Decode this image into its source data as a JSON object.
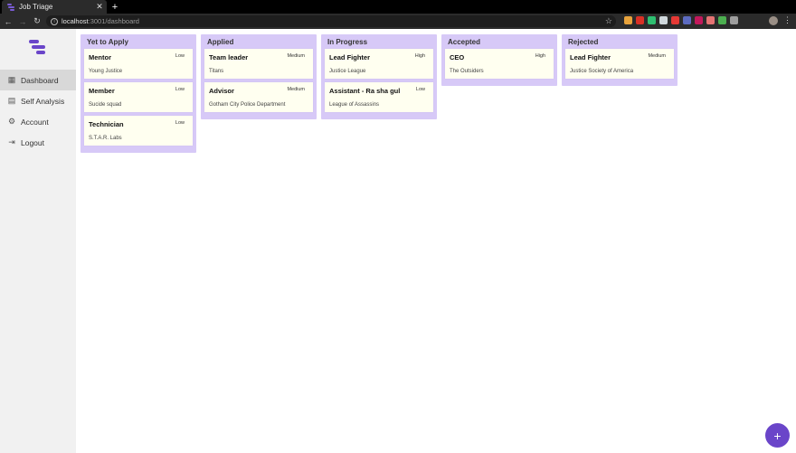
{
  "browser": {
    "tab_title": "Job Triage",
    "tab_close": "✕",
    "new_tab": "+",
    "url_host": "localhost",
    "url_path": ":3001/dashboard",
    "extension_colors": [
      "#e8a33c",
      "#d93025",
      "#2fbf71",
      "#cfd8dc",
      "#e53935",
      "#5c6bc0",
      "#c2185b",
      "#e57373",
      "#4caf50",
      "#9e9e9e"
    ]
  },
  "sidebar": {
    "items": [
      {
        "label": "Dashboard",
        "icon": "dashboard-icon",
        "glyph": "▦",
        "active": true
      },
      {
        "label": "Self Analysis",
        "icon": "clipboard-icon",
        "glyph": "▤",
        "active": false
      },
      {
        "label": "Account",
        "icon": "gear-icon",
        "glyph": "⚙",
        "active": false
      },
      {
        "label": "Logout",
        "icon": "logout-icon",
        "glyph": "⇥",
        "active": false
      }
    ]
  },
  "board": {
    "columns": [
      {
        "title": "Yet to Apply",
        "cards": [
          {
            "role": "Mentor",
            "priority": "Low",
            "company": "Young Justice"
          },
          {
            "role": "Member",
            "priority": "Low",
            "company": "Sucide squad"
          },
          {
            "role": "Technician",
            "priority": "Low",
            "company": "S.T.A.R. Labs"
          }
        ]
      },
      {
        "title": "Applied",
        "cards": [
          {
            "role": "Team leader",
            "priority": "Medium",
            "company": "Titans"
          },
          {
            "role": "Advisor",
            "priority": "Medium",
            "company": "Gotham City Police Department"
          }
        ]
      },
      {
        "title": "In Progress",
        "cards": [
          {
            "role": "Lead Fighter",
            "priority": "High",
            "company": "Justice League"
          },
          {
            "role": "Assistant - Ra sha gul",
            "priority": "Low",
            "company": "League of Assassins"
          }
        ]
      },
      {
        "title": "Accepted",
        "cards": [
          {
            "role": "CEO",
            "priority": "High",
            "company": "The Outsiders"
          }
        ]
      },
      {
        "title": "Rejected",
        "cards": [
          {
            "role": "Lead Fighter",
            "priority": "Medium",
            "company": "Justice Society of America"
          }
        ]
      }
    ]
  },
  "fab": {
    "label": "+"
  },
  "colors": {
    "accent": "#6a45c9",
    "column_bg": "#d7c9f7",
    "card_bg": "#fffff0",
    "sidebar_bg": "#f1f1f1",
    "sidebar_active": "#d8d8d8"
  }
}
